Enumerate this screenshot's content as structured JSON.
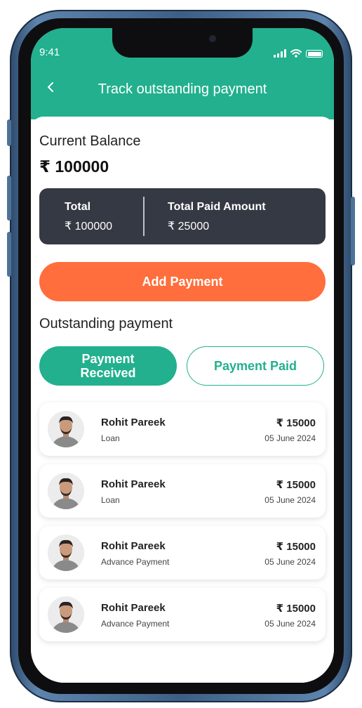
{
  "status_bar": {
    "time": "9:41"
  },
  "header": {
    "back_icon": "chevron-left-icon",
    "title": "Track outstanding payment"
  },
  "balance": {
    "label": "Current Balance",
    "value": "₹ 100000"
  },
  "summary": {
    "total_label": "Total",
    "total_value": "₹ 100000",
    "paid_label": "Total Paid Amount",
    "paid_value": "₹ 25000"
  },
  "add_payment_label": "Add Payment",
  "outstanding_label": "Outstanding payment",
  "tabs": [
    {
      "label": "Payment Received",
      "active": true
    },
    {
      "label": "Payment Paid",
      "active": false
    }
  ],
  "payments": [
    {
      "name": "Rohit Pareek",
      "type": "Loan",
      "amount": "₹ 15000",
      "date": "05 June 2024"
    },
    {
      "name": "Rohit Pareek",
      "type": "Loan",
      "amount": "₹ 15000",
      "date": "05 June 2024"
    },
    {
      "name": "Rohit Pareek",
      "type": "Advance Payment",
      "amount": "₹ 15000",
      "date": "05 June 2024"
    },
    {
      "name": "Rohit Pareek",
      "type": "Advance Payment",
      "amount": "₹ 15000",
      "date": "05 June 2024"
    }
  ],
  "colors": {
    "primary": "#22b08e",
    "accent": "#ff6e3c",
    "summary_bg": "#353944"
  }
}
